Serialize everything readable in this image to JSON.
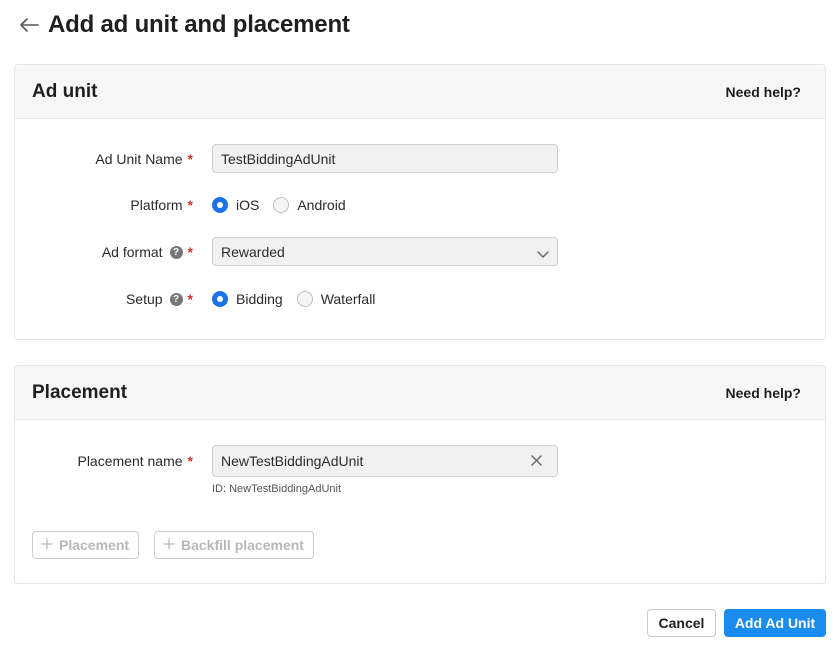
{
  "page": {
    "title": "Add ad unit and placement"
  },
  "ad_unit": {
    "section_title": "Ad unit",
    "help": "Need help?",
    "name_label": "Ad Unit Name",
    "name_value": "TestBiddingAdUnit",
    "platform_label": "Platform",
    "platform_options": [
      {
        "label": "iOS",
        "selected": true
      },
      {
        "label": "Android",
        "selected": false
      }
    ],
    "format_label": "Ad format",
    "format_value": "Rewarded",
    "setup_label": "Setup",
    "setup_options": [
      {
        "label": "Bidding",
        "selected": true
      },
      {
        "label": "Waterfall",
        "selected": false
      }
    ],
    "required_mark": "*",
    "help_icon_glyph": "?"
  },
  "placement": {
    "section_title": "Placement",
    "help": "Need help?",
    "name_label": "Placement name",
    "name_value": "NewTestBiddingAdUnit",
    "id_hint": "ID: NewTestBiddingAdUnit",
    "add_placement_label": "Placement",
    "add_backfill_label": "Backfill placement"
  },
  "footer": {
    "cancel_label": "Cancel",
    "submit_label": "Add Ad Unit"
  },
  "colors": {
    "accent": "#1a8cf0",
    "radio_selected": "#1a73e8",
    "required": "#d93025"
  }
}
